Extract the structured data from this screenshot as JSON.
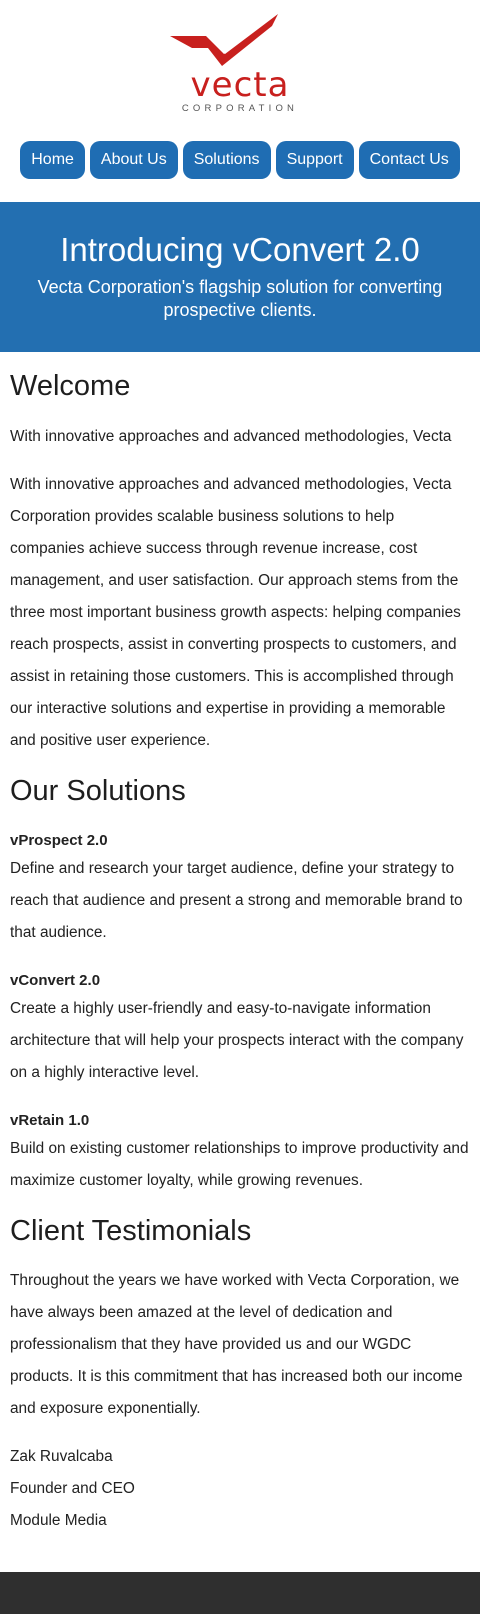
{
  "brand": {
    "name": "vecta",
    "tagline": "CORPORATION",
    "color": "#c8201e"
  },
  "nav": {
    "items": [
      "Home",
      "About Us",
      "Solutions",
      "Support",
      "Contact Us"
    ],
    "color": "#1f6db3"
  },
  "hero": {
    "title": "Introducing vConvert 2.0",
    "subtitle": "Vecta Corporation's flagship solution for converting prospective clients.",
    "background": "#236fb1"
  },
  "welcome": {
    "heading": "Welcome",
    "intro": "With innovative approaches and advanced methodologies, Vecta",
    "body": "With innovative approaches and advanced methodologies, Vecta Corporation provides scalable business solutions to help companies achieve success through revenue increase, cost management, and user satisfaction. Our approach stems from the three most important business growth aspects: helping companies reach prospects, assist in converting prospects to customers, and assist in retaining those customers. This is accomplished through our interactive solutions and expertise in providing a memorable and positive user experience."
  },
  "solutions": {
    "heading": "Our Solutions",
    "items": [
      {
        "title": "vProspect 2.0",
        "text": "Define and research your target audience, define your strategy to reach that audience and present a strong and memorable brand to that audience."
      },
      {
        "title": "vConvert 2.0",
        "text": "Create a highly user-friendly and easy-to-navigate information architecture that will help your prospects interact with the company on a highly interactive level."
      },
      {
        "title": "vRetain 1.0",
        "text": "Build on existing customer relationships to improve productivity and maximize customer loyalty, while growing revenues."
      }
    ]
  },
  "testimonials": {
    "heading": "Client Testimonials",
    "quote": "Throughout the years we have worked with Vecta Corporation, we have always been amazed at the level of dedication and professionalism that they have provided us and our WGDC products. It is this commitment that has increased both our income and exposure exponentially.",
    "name": "Zak Ruvalcaba",
    "role": "Founder and CEO",
    "company": "Module Media"
  },
  "footer": {
    "background": "#2f2f2f"
  }
}
